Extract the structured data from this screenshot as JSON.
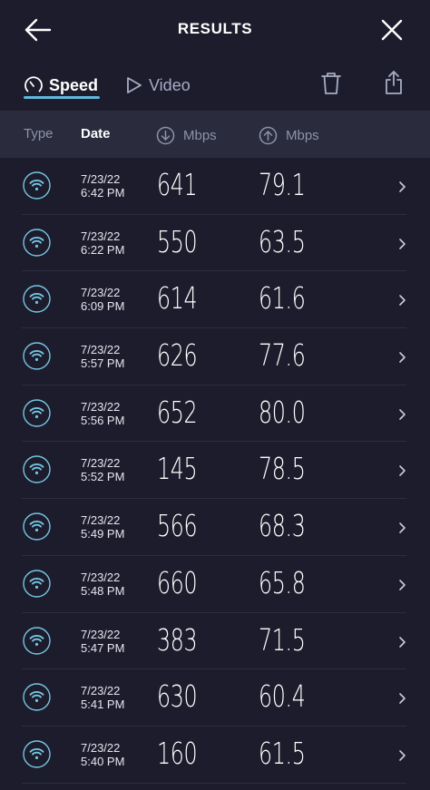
{
  "header": {
    "title": "RESULTS"
  },
  "tabs": [
    {
      "label": "Speed",
      "active": true
    },
    {
      "label": "Video",
      "active": false
    }
  ],
  "columns": {
    "type": "Type",
    "date": "Date",
    "download": "Mbps",
    "upload": "Mbps"
  },
  "colors": {
    "background": "#1c1c2c",
    "header_row": "#2a2b3d",
    "accent": "#5fb8e0",
    "icon_ring": "#76c6e2"
  },
  "icons": {
    "back": "arrow-left-icon",
    "close": "close-icon",
    "speed_tab": "gauge-icon",
    "video_tab": "play-icon",
    "trash": "trash-icon",
    "share": "share-icon",
    "row_type": "wifi-icon",
    "row_open": "chevron-right-icon"
  },
  "results": [
    {
      "date": "7/23/22",
      "time": "6:42 PM",
      "download": "641",
      "upload": "79.1"
    },
    {
      "date": "7/23/22",
      "time": "6:22 PM",
      "download": "550",
      "upload": "63.5"
    },
    {
      "date": "7/23/22",
      "time": "6:09 PM",
      "download": "614",
      "upload": "61.6"
    },
    {
      "date": "7/23/22",
      "time": "5:57 PM",
      "download": "626",
      "upload": "77.6"
    },
    {
      "date": "7/23/22",
      "time": "5:56 PM",
      "download": "652",
      "upload": "80.0"
    },
    {
      "date": "7/23/22",
      "time": "5:52 PM",
      "download": "145",
      "upload": "78.5"
    },
    {
      "date": "7/23/22",
      "time": "5:49 PM",
      "download": "566",
      "upload": "68.3"
    },
    {
      "date": "7/23/22",
      "time": "5:48 PM",
      "download": "660",
      "upload": "65.8"
    },
    {
      "date": "7/23/22",
      "time": "5:47 PM",
      "download": "383",
      "upload": "71.5"
    },
    {
      "date": "7/23/22",
      "time": "5:41 PM",
      "download": "630",
      "upload": "60.4"
    },
    {
      "date": "7/23/22",
      "time": "5:40 PM",
      "download": "160",
      "upload": "61.5"
    }
  ]
}
